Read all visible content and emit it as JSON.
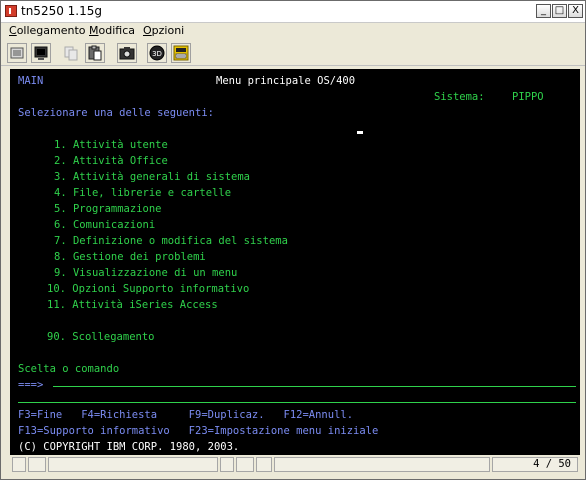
{
  "window": {
    "title": "tn5250 1.15g",
    "controls": [
      "_",
      "□",
      "X"
    ]
  },
  "menubar": {
    "items": [
      {
        "first": "C",
        "rest": "ollegamento"
      },
      {
        "first": "M",
        "rest": "odifica"
      },
      {
        "first": "O",
        "rest": "pzioni"
      }
    ]
  },
  "toolbar": {
    "buttons": [
      "list-icon",
      "monitor-icon",
      "copy-icon",
      "paste-icon",
      "camera-icon",
      "3d-icon",
      "printer-icon"
    ],
    "three_d_label": "3D"
  },
  "terminal": {
    "screen_id": "MAIN",
    "title": "Menu principale OS/400",
    "system_label": "Sistema:",
    "system_name": "PIPPO",
    "prompt": "Selezionare una delle seguenti:",
    "options": [
      {
        "num": "1.",
        "label": "Attività utente"
      },
      {
        "num": "2.",
        "label": "Attività Office"
      },
      {
        "num": "3.",
        "label": "Attività generali di sistema"
      },
      {
        "num": "4.",
        "label": "File, librerie e cartelle"
      },
      {
        "num": "5.",
        "label": "Programmazione"
      },
      {
        "num": "6.",
        "label": "Comunicazioni"
      },
      {
        "num": "7.",
        "label": "Definizione o modifica del sistema"
      },
      {
        "num": "8.",
        "label": "Gestione dei problemi"
      },
      {
        "num": "9.",
        "label": "Visualizzazione di un menu"
      },
      {
        "num": "10.",
        "label": "Opzioni Supporto informativo"
      },
      {
        "num": "11.",
        "label": "Attività iSeries Access"
      }
    ],
    "logoff": {
      "num": "90.",
      "label": "Scollegamento"
    },
    "command_label": "Scelta o comando",
    "command_arrow": "===>",
    "fkeys_line1": "F3=Fine   F4=Richiesta     F9=Duplicaz.   F12=Annull.",
    "fkeys_line2": "F13=Supporto informativo   F23=Impostazione menu iniziale",
    "copyright": "(C) COPYRIGHT IBM CORP. 1980, 2003."
  },
  "statusbar": {
    "page": "4 / 50"
  },
  "colors": {
    "terminal_bg": "#000000",
    "blue_text": "#7b8cf2",
    "green_text": "#2fd14b",
    "chrome": "#ece9d8"
  }
}
